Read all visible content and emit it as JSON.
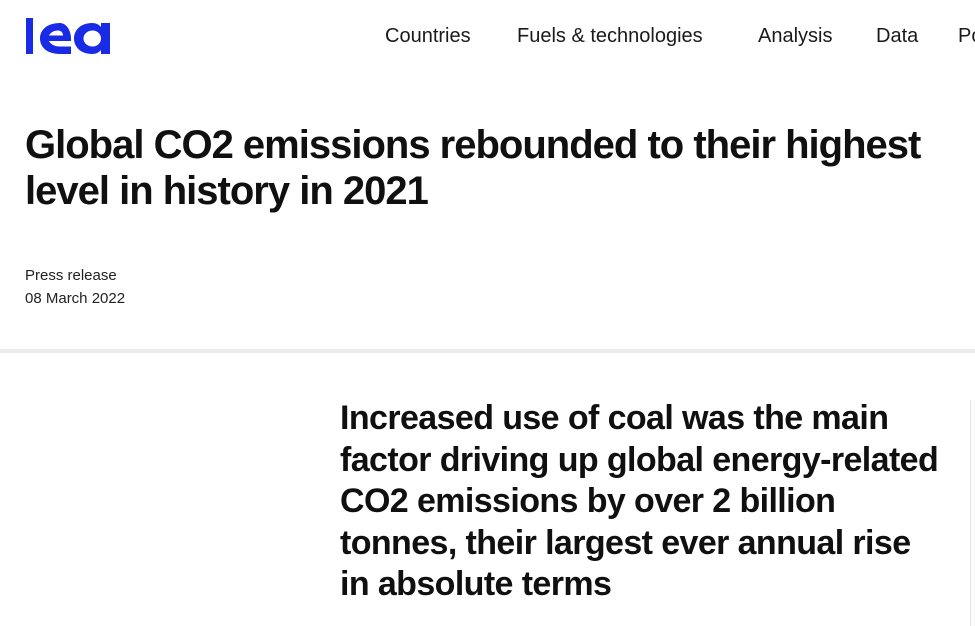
{
  "header": {
    "logo_label": "iea",
    "brand_color": "#1a2be6",
    "nav": [
      {
        "label": "Countries"
      },
      {
        "label": "Fuels & technologies"
      },
      {
        "label": "Analysis"
      },
      {
        "label": "Data"
      },
      {
        "label": "Po"
      }
    ]
  },
  "article": {
    "title": "Global CO2 emissions rebounded to their highest level in history in 2021",
    "type": "Press release",
    "date": "08 March 2022",
    "lead": "Increased use of coal was the main factor driving up global energy-related CO2 emissions by over 2 billion tonnes, their largest ever annual rise in absolute terms"
  }
}
